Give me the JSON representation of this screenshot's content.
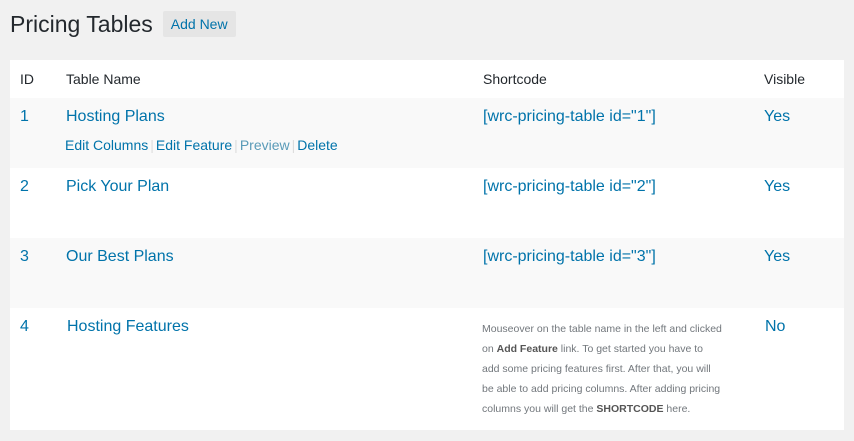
{
  "header": {
    "title": "Pricing Tables",
    "add_new_label": "Add New"
  },
  "columns": {
    "id": "ID",
    "name": "Table Name",
    "shortcode": "Shortcode",
    "visible": "Visible"
  },
  "rows": [
    {
      "id": "1",
      "name": "Hosting Plans",
      "shortcode": "[wrc-pricing-table id=\"1\"]",
      "visible": "Yes",
      "actions": {
        "edit_columns": "Edit Columns",
        "edit_feature": "Edit Feature",
        "preview": "Preview",
        "delete": "Delete"
      }
    },
    {
      "id": "2",
      "name": "Pick Your Plan",
      "shortcode": "[wrc-pricing-table id=\"2\"]",
      "visible": "Yes"
    },
    {
      "id": "3",
      "name": "Our Best Plans",
      "shortcode": "[wrc-pricing-table id=\"3\"]",
      "visible": "Yes"
    },
    {
      "id": "4",
      "name": "Hosting Features",
      "visible": "No",
      "hint": {
        "part1": "Mouseover on the table name in the left and clicked on ",
        "bold1": "Add Feature",
        "part2": " link. To get started you have to add some pricing features first. After that, you will be able to add pricing columns. After adding pricing columns you will get the ",
        "bold2": "SHORTCODE",
        "part3": " here."
      }
    }
  ],
  "colors": {
    "link": "#0073aa",
    "background": "#f1f1f1",
    "row_alt": "#f9f9f9"
  }
}
